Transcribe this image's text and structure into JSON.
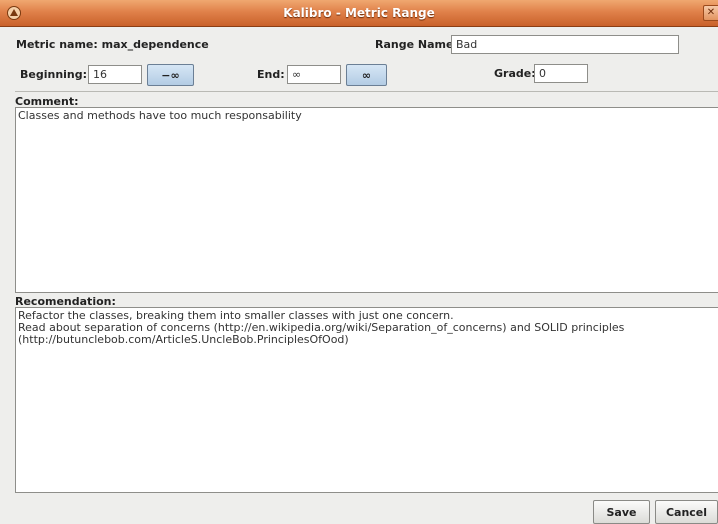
{
  "window": {
    "title": "Kalibro - Metric Range"
  },
  "metric": {
    "label": "Metric name: max_dependence"
  },
  "range_name": {
    "label": "Range Name:",
    "value": "Bad"
  },
  "beginning": {
    "label": "Beginning:",
    "value": "16",
    "button": "−∞"
  },
  "end": {
    "label": "End:",
    "value": "∞",
    "button": "∞"
  },
  "grade": {
    "label": "Grade:",
    "value": "0"
  },
  "comment": {
    "label": "Comment:",
    "text": "Classes and methods have too much responsability"
  },
  "recommendation": {
    "label": "Recomendation:",
    "text": "Refactor the classes, breaking them into smaller classes with just one concern.\nRead about separation of concerns (http://en.wikipedia.org/wiki/Separation_of_concerns) and SOLID principles\n(http://butunclebob.com/ArticleS.UncleBob.PrinciplesOfOod)"
  },
  "buttons": {
    "save": "Save",
    "cancel": "Cancel"
  },
  "colors": {
    "titlebar": "#e0814a",
    "button_blue": "#b3cce4",
    "background": "#eeeeec"
  },
  "icons": {
    "app": "kalibro-app-icon",
    "close": "close-icon"
  }
}
